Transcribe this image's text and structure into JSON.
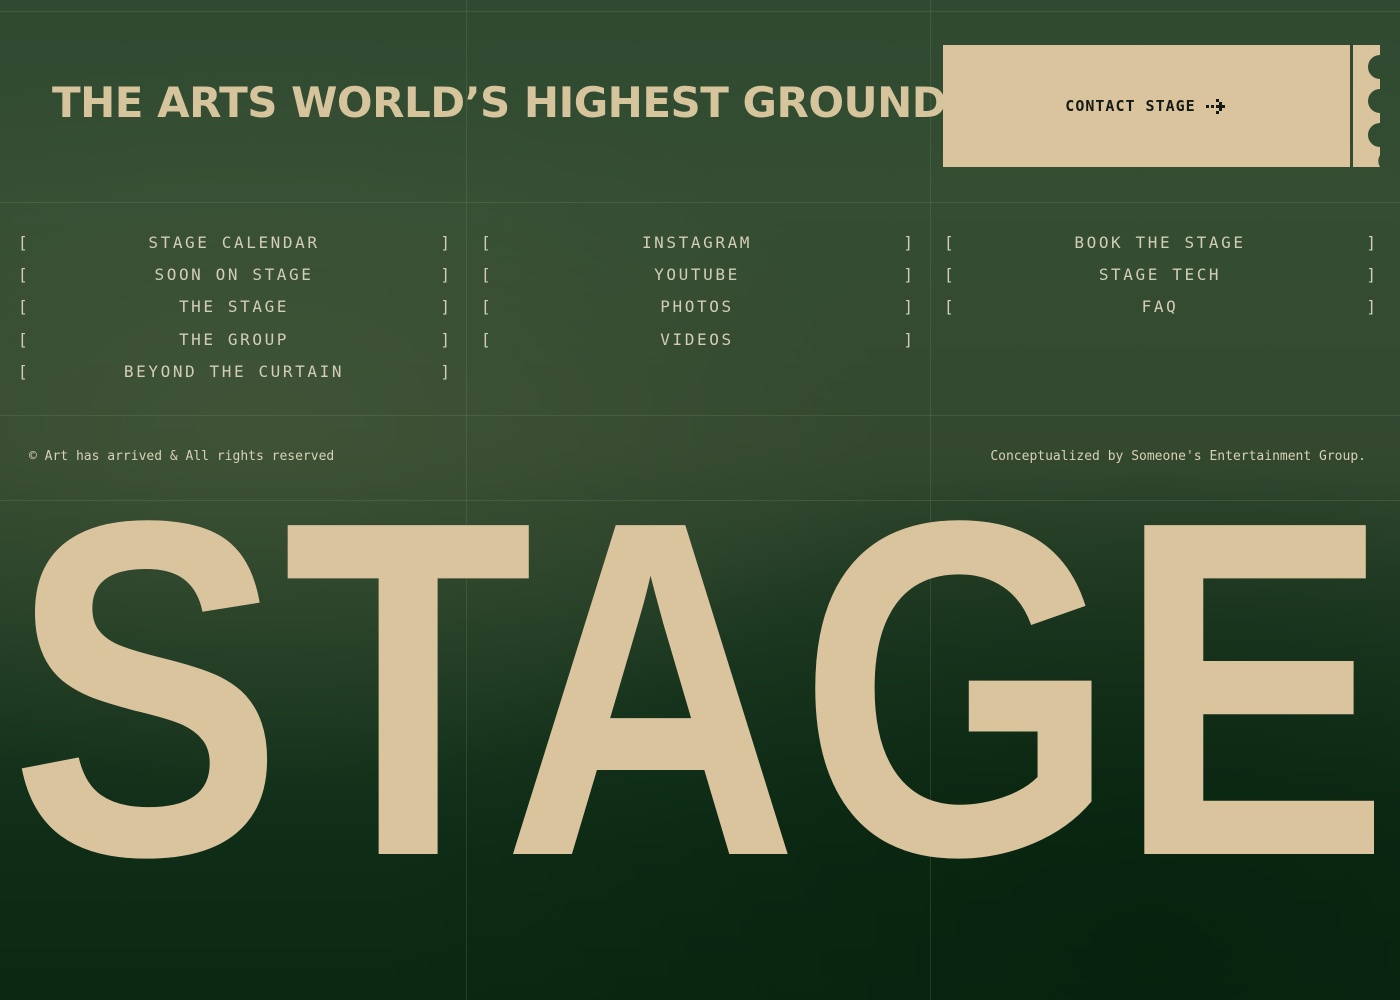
{
  "header": {
    "headline": "THE ARTS WORLD’S HIGHEST GROUND",
    "contact_label": "CONTACT STAGE"
  },
  "nav": {
    "column1": [
      "STAGE CALENDAR",
      "SOON ON STAGE",
      "THE STAGE",
      "THE GROUP",
      "BEYOND THE CURTAIN"
    ],
    "column2": [
      "INSTAGRAM",
      "YOUTUBE",
      "PHOTOS",
      "VIDEOS"
    ],
    "column3": [
      "BOOK THE STAGE",
      "STAGE TECH",
      "FAQ"
    ],
    "bracket_open": "[",
    "bracket_close": "]"
  },
  "footer": {
    "copyright": "© Art has arrived & All rights reserved",
    "credit": "Conceptualized by Someone's Entertainment Group."
  },
  "hero": {
    "word": "STAGE"
  },
  "icons": {
    "contact": "pixel-arrow-right-icon"
  },
  "colors": {
    "accent": "#d9c49e",
    "background": "#2f4a30",
    "background_dark": "#0b2812",
    "text_light": "#d3cdb8",
    "ticket_text": "#141a12"
  }
}
